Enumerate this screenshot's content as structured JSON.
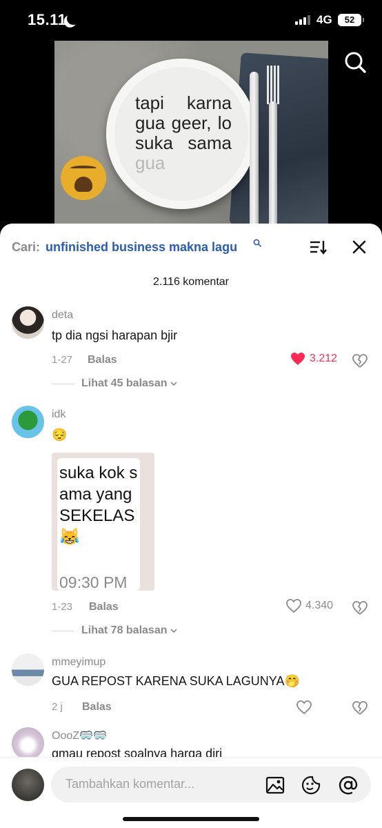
{
  "status_bar": {
    "time": "15.11",
    "network": "4G",
    "battery": "52"
  },
  "video": {
    "plate_words": [
      "tapi karna gua geer, lo suka sama"
    ],
    "plate_fade_word": "gua"
  },
  "search": {
    "label": "Cari:",
    "query": "unfinished business makna lagu"
  },
  "comment_count": "2.116 komentar",
  "comments": [
    {
      "username": "deta",
      "text": "tp dia ngsi harapan bjir",
      "date": "1-27",
      "reply_label": "Balas",
      "likes": "3.212",
      "liked": true,
      "view_replies": "Lihat 45 balasan"
    },
    {
      "username": "idk",
      "text": "😔",
      "date": "1-23",
      "reply_label": "Balas",
      "likes": "4.340",
      "liked": false,
      "sticker_text": "suka kok sama yang SEKELAS 😹",
      "sticker_time": "09:30 PM",
      "view_replies": "Lihat 78 balasan"
    },
    {
      "username": "mmeyimup",
      "text": "GUA REPOST KARENA SUKA LAGUNYA🤭",
      "date": "2 j",
      "reply_label": "Balas",
      "likes": "",
      "liked": false
    },
    {
      "username": "OooZ🥽🥽",
      "text": "gmau repost soalnya harga diri"
    }
  ],
  "input": {
    "placeholder": "Tambahkan komentar..."
  },
  "colors": {
    "accent_link": "#2a5db0",
    "like_active": "#fe2c55"
  }
}
